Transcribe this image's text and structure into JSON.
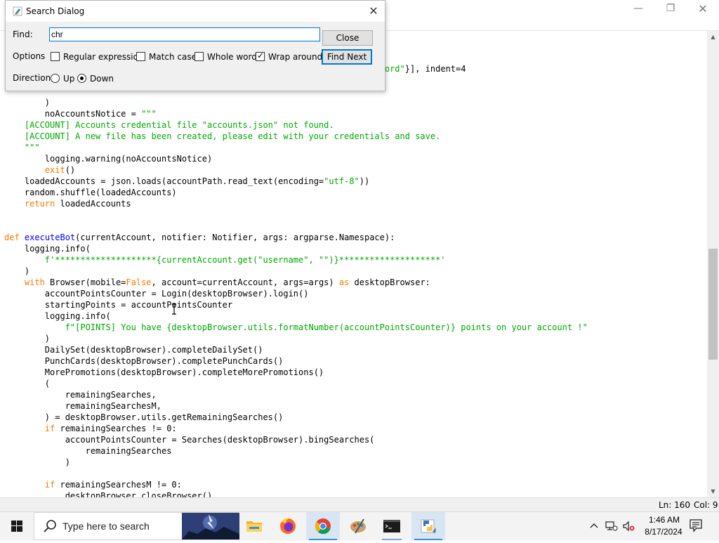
{
  "window": {
    "controls": {
      "minimize": "—",
      "maximize": "❐",
      "close": "✕"
    }
  },
  "code": {
    "lines": [
      {
        "row": 3,
        "tokens": [
          {
            "t": "                                                                           ",
            "c": "n"
          },
          {
            "t": "ord\"",
            "c": "s"
          },
          {
            "t": "}], indent=4",
            "c": "n"
          }
        ]
      },
      {
        "row": 6,
        "tokens": [
          {
            "t": "        )",
            "c": "n"
          }
        ]
      },
      {
        "row": 7,
        "tokens": [
          {
            "t": "        noAccountsNotice = ",
            "c": "n"
          },
          {
            "t": "\"\"\"",
            "c": "s"
          }
        ]
      },
      {
        "row": 8,
        "tokens": [
          {
            "t": "    [ACCOUNT] Accounts credential file \"accounts.json\" not found.",
            "c": "s"
          }
        ]
      },
      {
        "row": 9,
        "tokens": [
          {
            "t": "    [ACCOUNT] A new file has been created, please edit with your credentials and save.",
            "c": "s"
          }
        ]
      },
      {
        "row": 10,
        "tokens": [
          {
            "t": "    \"\"\"",
            "c": "s"
          }
        ]
      },
      {
        "row": 11,
        "tokens": [
          {
            "t": "        logging.warning(noAccountsNotice)",
            "c": "n"
          }
        ]
      },
      {
        "row": 12,
        "tokens": [
          {
            "t": "        ",
            "c": "n"
          },
          {
            "t": "exit",
            "c": "k"
          },
          {
            "t": "()",
            "c": "n"
          }
        ]
      },
      {
        "row": 13,
        "tokens": [
          {
            "t": "    loadedAccounts = json.loads(accountPath.read_text(encoding=",
            "c": "n"
          },
          {
            "t": "\"utf-8\"",
            "c": "s"
          },
          {
            "t": "))",
            "c": "n"
          }
        ]
      },
      {
        "row": 14,
        "tokens": [
          {
            "t": "    random.shuffle(loadedAccounts)",
            "c": "n"
          }
        ]
      },
      {
        "row": 15,
        "tokens": [
          {
            "t": "    ",
            "c": "n"
          },
          {
            "t": "return",
            "c": "k"
          },
          {
            "t": " loadedAccounts",
            "c": "n"
          }
        ]
      },
      {
        "row": 18,
        "tokens": [
          {
            "t": "def",
            "c": "k"
          },
          {
            "t": " ",
            "c": "n"
          },
          {
            "t": "executeBot",
            "c": "d"
          },
          {
            "t": "(currentAccount, notifier: Notifier, args: argparse.Namespace):",
            "c": "n"
          }
        ]
      },
      {
        "row": 19,
        "tokens": [
          {
            "t": "    logging.info(",
            "c": "n"
          }
        ]
      },
      {
        "row": 20,
        "tokens": [
          {
            "t": "        ",
            "c": "n"
          },
          {
            "t": "f'********************{currentAccount.get(\"username\", \"\")}********************'",
            "c": "s"
          }
        ]
      },
      {
        "row": 21,
        "tokens": [
          {
            "t": "    )",
            "c": "n"
          }
        ]
      },
      {
        "row": 22,
        "tokens": [
          {
            "t": "    ",
            "c": "n"
          },
          {
            "t": "with",
            "c": "k"
          },
          {
            "t": " Browser(mobile=",
            "c": "n"
          },
          {
            "t": "False",
            "c": "k"
          },
          {
            "t": ", account=currentAccount, args=args) ",
            "c": "n"
          },
          {
            "t": "as",
            "c": "k"
          },
          {
            "t": " desktopBrowser:",
            "c": "n"
          }
        ]
      },
      {
        "row": 23,
        "tokens": [
          {
            "t": "        accountPointsCounter = Login(desktopBrowser).login()",
            "c": "n"
          }
        ]
      },
      {
        "row": 24,
        "tokens": [
          {
            "t": "        startingPoints = accountPointsCounter",
            "c": "n"
          }
        ]
      },
      {
        "row": 25,
        "tokens": [
          {
            "t": "        logging.info(",
            "c": "n"
          }
        ]
      },
      {
        "row": 26,
        "tokens": [
          {
            "t": "            ",
            "c": "n"
          },
          {
            "t": "f\"[POINTS] You have {desktopBrowser.utils.formatNumber(accountPointsCounter)} points on your account !\"",
            "c": "s"
          }
        ]
      },
      {
        "row": 27,
        "tokens": [
          {
            "t": "        )",
            "c": "n"
          }
        ]
      },
      {
        "row": 28,
        "tokens": [
          {
            "t": "        DailySet(desktopBrowser).completeDailySet()",
            "c": "n"
          }
        ]
      },
      {
        "row": 29,
        "tokens": [
          {
            "t": "        PunchCards(desktopBrowser).completePunchCards()",
            "c": "n"
          }
        ]
      },
      {
        "row": 30,
        "tokens": [
          {
            "t": "        MorePromotions(desktopBrowser).completeMorePromotions()",
            "c": "n"
          }
        ]
      },
      {
        "row": 31,
        "tokens": [
          {
            "t": "        (",
            "c": "n"
          }
        ]
      },
      {
        "row": 32,
        "tokens": [
          {
            "t": "            remainingSearches,",
            "c": "n"
          }
        ]
      },
      {
        "row": 33,
        "tokens": [
          {
            "t": "            remainingSearchesM,",
            "c": "n"
          }
        ]
      },
      {
        "row": 34,
        "tokens": [
          {
            "t": "        ) = desktopBrowser.utils.getRemainingSearches()",
            "c": "n"
          }
        ]
      },
      {
        "row": 35,
        "tokens": [
          {
            "t": "        ",
            "c": "n"
          },
          {
            "t": "if",
            "c": "k"
          },
          {
            "t": " remainingSearches != 0:",
            "c": "n"
          }
        ]
      },
      {
        "row": 36,
        "tokens": [
          {
            "t": "            accountPointsCounter = Searches(desktopBrowser).bingSearches(",
            "c": "n"
          }
        ]
      },
      {
        "row": 37,
        "tokens": [
          {
            "t": "                remainingSearches",
            "c": "n"
          }
        ]
      },
      {
        "row": 38,
        "tokens": [
          {
            "t": "            )",
            "c": "n"
          }
        ]
      },
      {
        "row": 40,
        "tokens": [
          {
            "t": "        ",
            "c": "n"
          },
          {
            "t": "if",
            "c": "k"
          },
          {
            "t": " remainingSearchesM != 0:",
            "c": "n"
          }
        ]
      },
      {
        "row": 41,
        "tokens": [
          {
            "t": "            desktopBrowser.closeBrowser()",
            "c": "n"
          }
        ]
      }
    ]
  },
  "scrollbar": {
    "position": 0.62,
    "visible_fraction": 0.25
  },
  "status": {
    "line": "Ln: 160",
    "col": "Col: 9"
  },
  "dialog": {
    "title": "Search Dialog",
    "close_glyph": "✕",
    "find_label": "Find:",
    "find_value": "chr",
    "close_button": "Close",
    "options_label": "Options",
    "options": [
      {
        "label": "Regular expression",
        "checked": false
      },
      {
        "label": "Match case",
        "checked": false
      },
      {
        "label": "Whole word",
        "checked": false
      },
      {
        "label": "Wrap around",
        "checked": true
      }
    ],
    "find_next_button": "Find Next",
    "direction_label": "Direction",
    "direction_options": [
      {
        "label": "Up",
        "selected": false
      },
      {
        "label": "Down",
        "selected": true
      }
    ]
  },
  "taskbar": {
    "search_placeholder": "Type here to search",
    "apps": [
      {
        "name": "file-explorer",
        "icon": "folder-icon"
      },
      {
        "name": "firefox",
        "icon": "firefox-icon"
      },
      {
        "name": "chrome",
        "icon": "chrome-icon",
        "active": true
      },
      {
        "name": "paint",
        "icon": "paint-palette-icon"
      },
      {
        "name": "terminal",
        "icon": "terminal-icon"
      },
      {
        "name": "python-idle",
        "icon": "python-icon",
        "active": true
      }
    ],
    "clock_time": "1:46 AM",
    "clock_date": "8/17/2024"
  },
  "colors": {
    "keyword": "#ff7700",
    "builtin_def": "#0000ff",
    "string": "#00aa00",
    "accent": "#0078d7"
  }
}
